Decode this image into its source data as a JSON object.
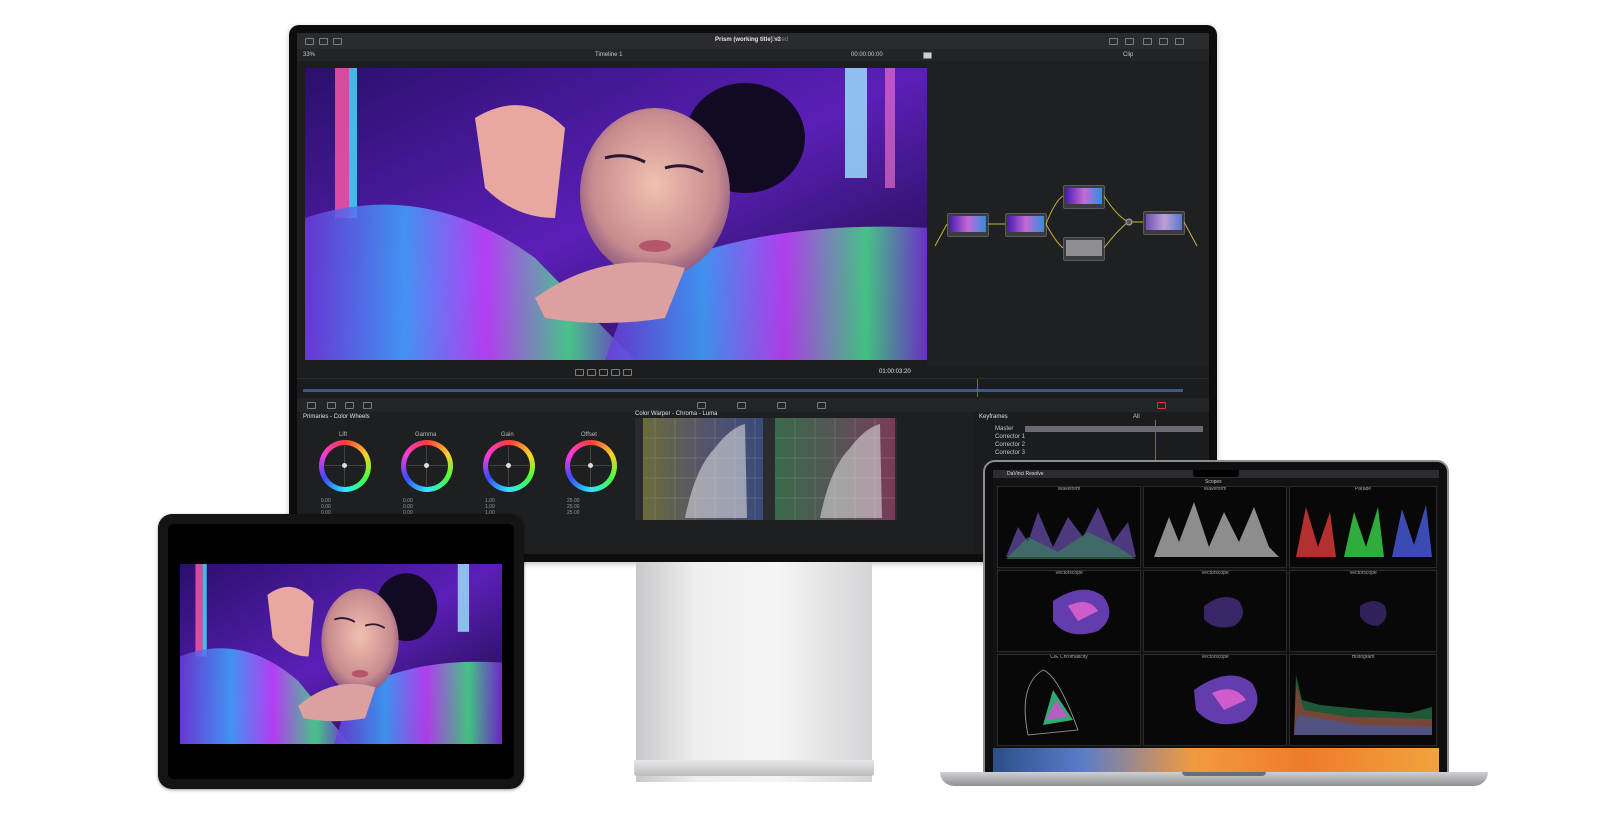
{
  "app": {
    "project_title": "Prism (working title) v2",
    "project_status": "Edited",
    "timeline_name": "Timeline 1",
    "zoom": "33%",
    "timecode_top": "00:00:00:00",
    "clip_label": "Clip",
    "timecode_viewer": "01:00:03:20"
  },
  "color_wheels": {
    "panel_title": "Primaries - Color Wheels",
    "wheels": [
      {
        "label": "Lift",
        "values": "0.00  0.00  0.00  0.00"
      },
      {
        "label": "Gamma",
        "values": "0.00  0.00  0.00  0.00"
      },
      {
        "label": "Gain",
        "values": "1.00  1.00  1.00  1.00"
      },
      {
        "label": "Offset",
        "values": "25.00  25.00  25.00"
      }
    ]
  },
  "warper": {
    "panel_title": "Color Warper - Chroma - Luma"
  },
  "keyframes": {
    "panel_title": "Keyframes",
    "filter": "All",
    "rows": [
      "Master",
      "Corrector 1",
      "Corrector 2",
      "Corrector 3"
    ]
  },
  "macbook": {
    "app_name": "DaVinci Resolve",
    "scopes_title": "Scopes",
    "scopes": [
      {
        "label": "Waveform"
      },
      {
        "label": "Waveform"
      },
      {
        "label": "Parade"
      },
      {
        "label": "Vectorscope"
      },
      {
        "label": "Vectorscope"
      },
      {
        "label": "Vectorscope"
      },
      {
        "label": "CIE Chromaticity"
      },
      {
        "label": "Vectorscope"
      },
      {
        "label": "Histogram"
      }
    ]
  }
}
